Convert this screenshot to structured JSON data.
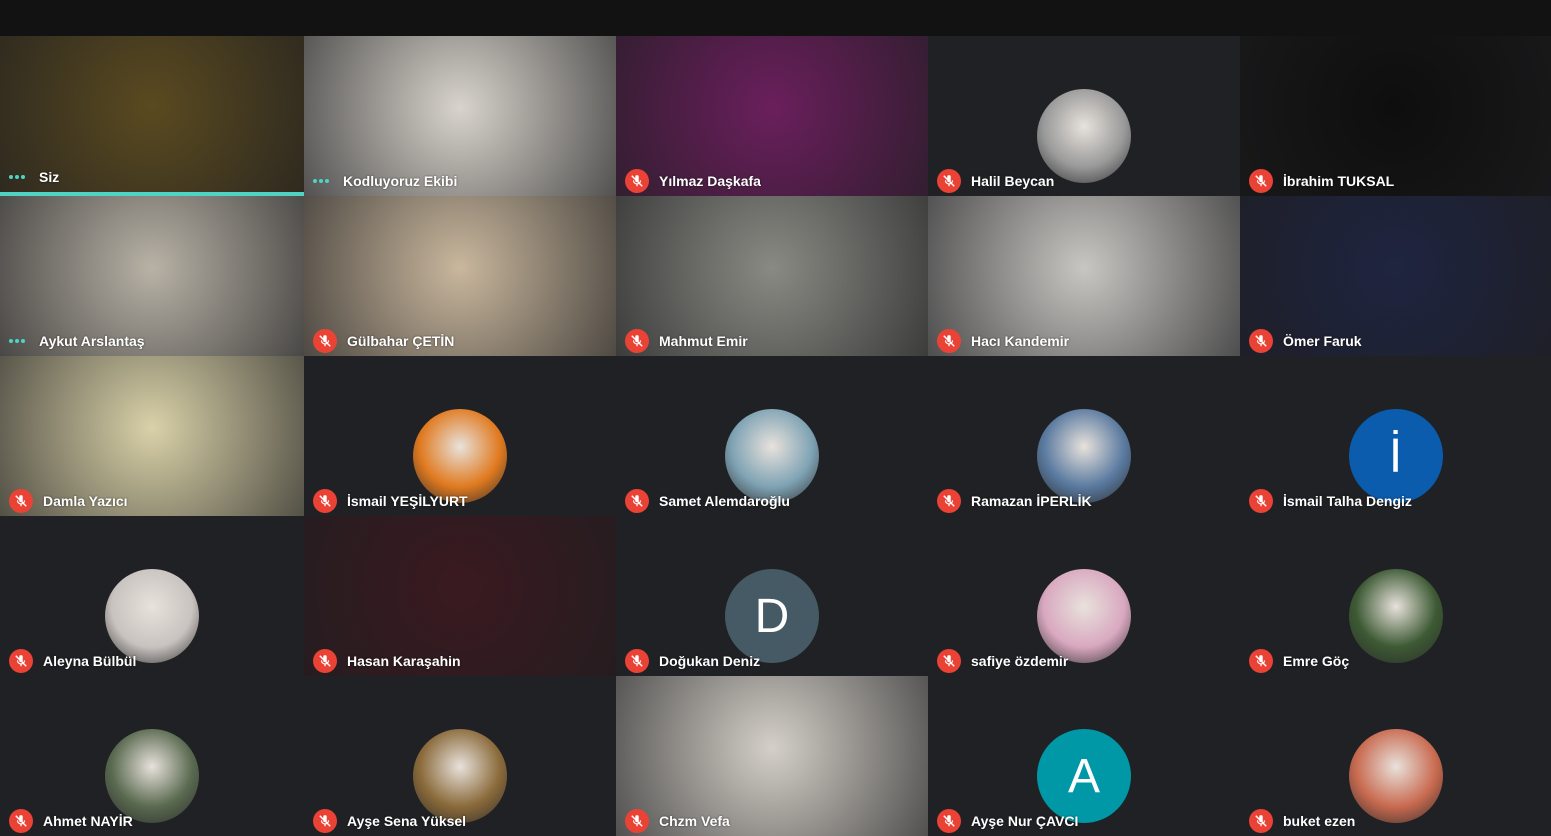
{
  "participants": [
    {
      "name": "Siz",
      "status": "speaking",
      "self": true,
      "tile": "video",
      "bg": "#5a4a20"
    },
    {
      "name": "Kodluyoruz Ekibi",
      "status": "speaking",
      "tile": "video",
      "bg": "#d8d4cc"
    },
    {
      "name": "Yılmaz Daşkafa",
      "status": "muted",
      "tile": "video",
      "bg": "#6a1f5c"
    },
    {
      "name": "Halil Beycan",
      "status": "muted",
      "tile": "avatar",
      "avatar_type": "photo",
      "avatar_color": "#9a9a9a"
    },
    {
      "name": "İbrahim TUKSAL",
      "status": "muted",
      "tile": "video",
      "bg": "#0e0e0e"
    },
    {
      "name": "Aykut Arslantaş",
      "status": "speaking",
      "tile": "video",
      "bg": "#b8b2a6"
    },
    {
      "name": "Gülbahar ÇETİN",
      "status": "muted",
      "tile": "video",
      "bg": "#c9b79d"
    },
    {
      "name": "Mahmut Emir",
      "status": "muted",
      "tile": "video",
      "bg": "#8a8a84"
    },
    {
      "name": "Hacı Kandemir",
      "status": "muted",
      "tile": "video",
      "bg": "#c8c6c2"
    },
    {
      "name": "Ömer Faruk",
      "status": "muted",
      "tile": "video",
      "bg": "#1f2440"
    },
    {
      "name": "Damla Yazıcı",
      "status": "muted",
      "tile": "video",
      "bg": "#d9d1a8"
    },
    {
      "name": "İsmail YEŞİLYURT",
      "status": "muted",
      "tile": "avatar",
      "avatar_type": "photo",
      "avatar_color": "#e07a20"
    },
    {
      "name": "Samet Alemdaroğlu",
      "status": "muted",
      "tile": "avatar",
      "avatar_type": "photo",
      "avatar_color": "#7fa3b4"
    },
    {
      "name": "Ramazan İPERLİK",
      "status": "muted",
      "tile": "avatar",
      "avatar_type": "photo",
      "avatar_color": "#5a7aa0"
    },
    {
      "name": "İsmail Talha Dengiz",
      "status": "muted",
      "tile": "avatar",
      "avatar_type": "letter",
      "letter": "İ",
      "avatar_color": "#0b5cad"
    },
    {
      "name": "Aleyna Bülbül",
      "status": "muted",
      "tile": "avatar",
      "avatar_type": "photo",
      "avatar_color": "#c9c3c0"
    },
    {
      "name": "Hasan Karaşahin",
      "status": "muted",
      "tile": "video",
      "bg": "#3a1a20"
    },
    {
      "name": "Doğukan Deniz",
      "status": "muted",
      "tile": "avatar",
      "avatar_type": "letter",
      "letter": "D",
      "avatar_color": "#455a64"
    },
    {
      "name": "safiye özdemir",
      "status": "muted",
      "tile": "avatar",
      "avatar_type": "photo",
      "avatar_color": "#d9a8c0"
    },
    {
      "name": "Emre Göç",
      "status": "muted",
      "tile": "avatar",
      "avatar_type": "photo",
      "avatar_color": "#3d5a34"
    },
    {
      "name": "Ahmet NAYİR",
      "status": "muted",
      "tile": "avatar",
      "avatar_type": "photo",
      "avatar_color": "#5a6a50"
    },
    {
      "name": "Ayşe Sena Yüksel",
      "status": "muted",
      "tile": "avatar",
      "avatar_type": "photo",
      "avatar_color": "#8a6a3a"
    },
    {
      "name": "Chzm Vefa",
      "status": "muted",
      "tile": "video",
      "bg": "#d4d0c8"
    },
    {
      "name": "Ayşe Nur ÇAVCI",
      "status": "muted",
      "tile": "avatar",
      "avatar_type": "letter",
      "letter": "A",
      "avatar_color": "#0097a7"
    },
    {
      "name": "buket ezen",
      "status": "muted",
      "tile": "avatar",
      "avatar_type": "photo",
      "avatar_color": "#c96a50"
    }
  ]
}
